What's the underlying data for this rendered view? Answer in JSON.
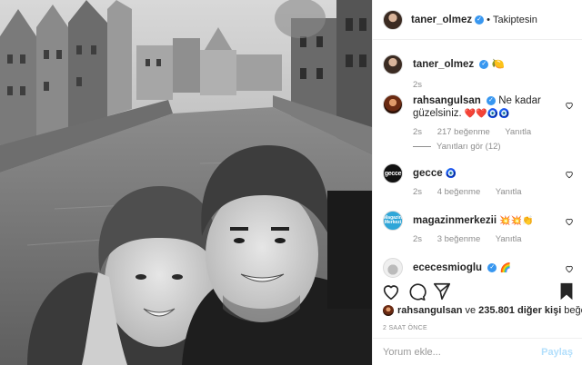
{
  "post": {
    "author": "taner_olmez",
    "follow_state": "Takiptesin",
    "separator": "•"
  },
  "caption": {
    "author": "taner_olmez",
    "emoji": "🍋",
    "time": "2s"
  },
  "comments": [
    {
      "author": "rahsangulsan",
      "text": "Ne kadar güzelsiniz.",
      "emoji": "❤️❤️🧿🧿",
      "time": "2s",
      "likes": "217 beğenme",
      "reply": "Yanıtla",
      "view_replies": "Yanıtları gör (12)"
    },
    {
      "author": "gecce",
      "emoji": "🧿",
      "time": "2s",
      "likes": "4 beğenme",
      "reply": "Yanıtla"
    },
    {
      "author": "magazinmerkezii",
      "emoji": "💥💥👏",
      "time": "2s",
      "likes": "3 beğenme",
      "reply": "Yanıtla"
    },
    {
      "author": "ececesmioglu",
      "emoji": "🌈"
    }
  ],
  "avatar_text": {
    "gecce": "gecce",
    "magazin": "Magazin Merkezi"
  },
  "likes": {
    "first_user": "rahsangulsan",
    "connector": "ve",
    "others": "235.801 diğer kişi",
    "suffix": "beğendi"
  },
  "time_ago": "2 SAAT ÖNCE",
  "add_comment": {
    "placeholder": "Yorum ekle...",
    "post_label": "Paylaş"
  },
  "colors": {
    "verified": "#3897f0",
    "muted_text": "#8e8e8e",
    "post_button": "#b2dffc"
  }
}
